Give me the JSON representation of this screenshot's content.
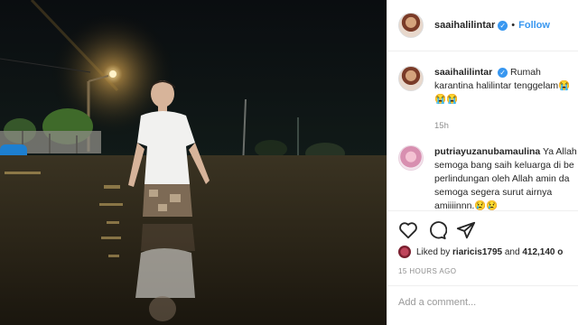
{
  "post": {
    "username": "saaihalilintar",
    "follow_label": "Follow",
    "separator": "•"
  },
  "caption": {
    "username": "saaihalilintar",
    "text": "Rumah karantina halilintar tenggelam😭😭😭",
    "time": "15h"
  },
  "comment": {
    "username": "putriayuzanubamaulina",
    "text": "Ya Allah semoga bang saih keluarga di be perlindungan oleh Allah amin da semoga segera surut airnya amiiiinnn.😢😢"
  },
  "likes": {
    "prefix": "Liked by",
    "user": "riaricis1795",
    "connector": "and",
    "count": "412,140 o"
  },
  "timestamp": "15 HOURS AGO",
  "add_comment_placeholder": "Add a comment...",
  "icons": [
    "heart-icon",
    "comment-icon",
    "share-icon",
    "verified-icon"
  ],
  "colors": {
    "accent": "#3897f0",
    "text": "#262626",
    "muted": "#8e8e8e",
    "border": "#efefef"
  }
}
